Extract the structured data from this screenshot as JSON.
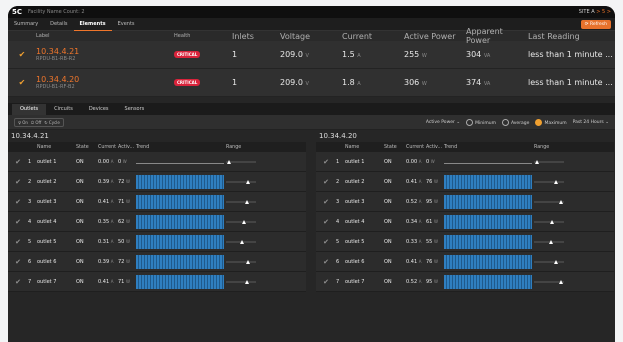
{
  "app": {
    "logo": "5C",
    "facility": "Facility Name Count: 2",
    "site": "SITE A",
    "site_suffix": "> 5 >"
  },
  "nav": {
    "tabs": [
      "Summary",
      "Details",
      "Elements",
      "Events"
    ],
    "active": 2,
    "refresh": "Refresh"
  },
  "devices": {
    "headers": {
      "label": "Label",
      "health": "Health",
      "inlets": "Inlets",
      "voltage": "Voltage",
      "current": "Current",
      "active_power": "Active Power",
      "apparent_power": "Apparent Power",
      "last_reading": "Last Reading"
    },
    "rows": [
      {
        "ip": "10.34.4.21",
        "sub": "RPDU-B1-RB-R2",
        "health": "CRITICAL",
        "inlets": "1",
        "voltage": "209.0",
        "voltage_unit": "V",
        "current": "1.5",
        "current_unit": "A",
        "active_power": "255",
        "active_unit": "W",
        "apparent": "304",
        "apparent_unit": "VA",
        "last": "less than 1 minute ..."
      },
      {
        "ip": "10.34.4.20",
        "sub": "RPDU-B1-RF-B2",
        "health": "CRITICAL",
        "inlets": "1",
        "voltage": "209.0",
        "voltage_unit": "V",
        "current": "1.8",
        "current_unit": "A",
        "active_power": "306",
        "active_unit": "W",
        "apparent": "374",
        "apparent_unit": "VA",
        "last": "less than 1 minute ..."
      }
    ]
  },
  "subtabs": {
    "items": [
      "Outlets",
      "Circuits",
      "Devices",
      "Sensors"
    ],
    "active": 0
  },
  "controls": {
    "on": "On",
    "off": "Off",
    "cycle": "Cycle",
    "metric": "Active Power",
    "minimum": "Minimum",
    "average": "Average",
    "maximum": "Maximum",
    "period": "Past 24 Hours"
  },
  "panels": [
    {
      "title": "10.34.4.21",
      "headers": {
        "name": "Name",
        "state": "State",
        "current": "Current",
        "active": "Activ...",
        "trend": "Trend",
        "range": "Range"
      },
      "rows": [
        {
          "num": "1",
          "name": "outlet 1",
          "state": "ON",
          "current": "0.00",
          "cu": "A",
          "active": "0",
          "au": "W",
          "trend": "flat",
          "range": 0.05
        },
        {
          "num": "2",
          "name": "outlet 2",
          "state": "ON",
          "current": "0.39",
          "cu": "A",
          "active": "72",
          "au": "W",
          "trend": "bar",
          "range": 0.75
        },
        {
          "num": "3",
          "name": "outlet 3",
          "state": "ON",
          "current": "0.41",
          "cu": "A",
          "active": "71",
          "au": "W",
          "trend": "bar",
          "range": 0.72
        },
        {
          "num": "4",
          "name": "outlet 4",
          "state": "ON",
          "current": "0.35",
          "cu": "A",
          "active": "62",
          "au": "W",
          "trend": "bar",
          "range": 0.63
        },
        {
          "num": "5",
          "name": "outlet 5",
          "state": "ON",
          "current": "0.31",
          "cu": "A",
          "active": "50",
          "au": "W",
          "trend": "bar",
          "range": 0.52
        },
        {
          "num": "6",
          "name": "outlet 6",
          "state": "ON",
          "current": "0.39",
          "cu": "A",
          "active": "72",
          "au": "W",
          "trend": "bar",
          "range": 0.75
        },
        {
          "num": "7",
          "name": "outlet 7",
          "state": "ON",
          "current": "0.41",
          "cu": "A",
          "active": "71",
          "au": "W",
          "trend": "bar",
          "range": 0.72
        }
      ]
    },
    {
      "title": "10.34.4.20",
      "headers": {
        "name": "Name",
        "state": "State",
        "current": "Current",
        "active": "Activ...",
        "trend": "Trend",
        "range": "Range"
      },
      "rows": [
        {
          "num": "1",
          "name": "outlet 1",
          "state": "ON",
          "current": "0.00",
          "cu": "A",
          "active": "0",
          "au": "W",
          "trend": "flat",
          "range": 0.05
        },
        {
          "num": "2",
          "name": "outlet 2",
          "state": "ON",
          "current": "0.41",
          "cu": "A",
          "active": "76",
          "au": "W",
          "trend": "bar",
          "range": 0.78
        },
        {
          "num": "3",
          "name": "outlet 3",
          "state": "ON",
          "current": "0.52",
          "cu": "A",
          "active": "95",
          "au": "W",
          "trend": "bar",
          "range": 0.95
        },
        {
          "num": "4",
          "name": "outlet 4",
          "state": "ON",
          "current": "0.34",
          "cu": "A",
          "active": "61",
          "au": "W",
          "trend": "bar",
          "range": 0.62
        },
        {
          "num": "5",
          "name": "outlet 5",
          "state": "ON",
          "current": "0.33",
          "cu": "A",
          "active": "55",
          "au": "W",
          "trend": "bar",
          "range": 0.56
        },
        {
          "num": "6",
          "name": "outlet 6",
          "state": "ON",
          "current": "0.41",
          "cu": "A",
          "active": "76",
          "au": "W",
          "trend": "bar",
          "range": 0.78
        },
        {
          "num": "7",
          "name": "outlet 7",
          "state": "ON",
          "current": "0.52",
          "cu": "A",
          "active": "95",
          "au": "W",
          "trend": "bar",
          "range": 0.95
        }
      ]
    }
  ]
}
